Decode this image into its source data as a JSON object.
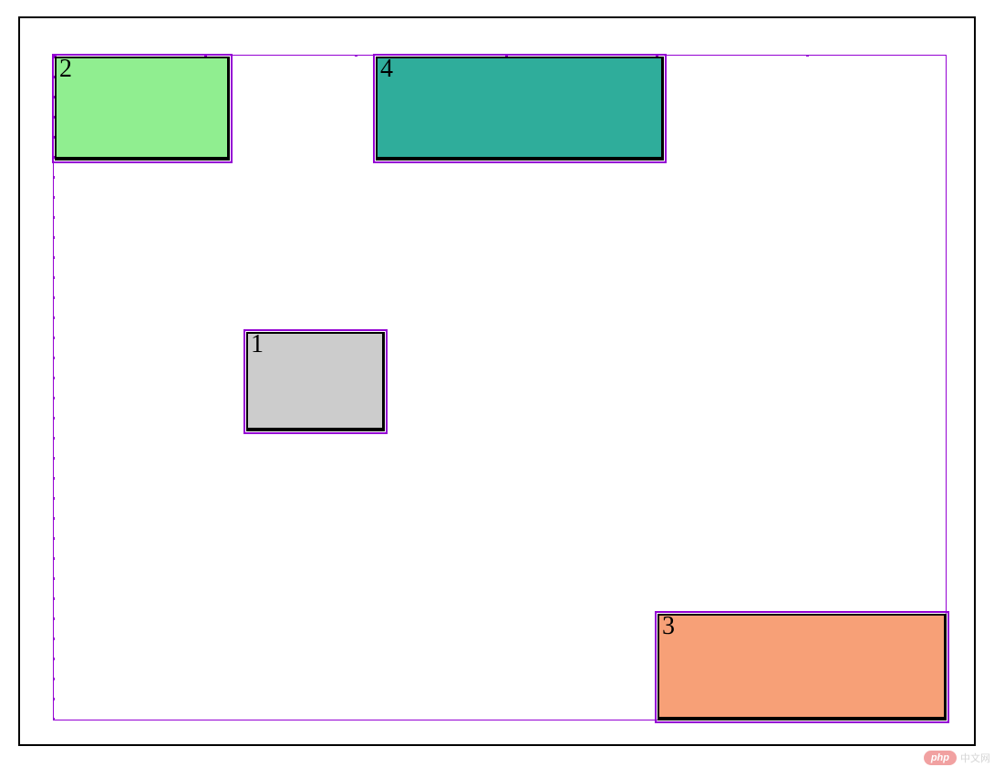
{
  "boxes": {
    "box1": {
      "label": "1",
      "color": "#cccccc"
    },
    "box2": {
      "label": "2",
      "color": "#90ee90"
    },
    "box3": {
      "label": "3",
      "color": "#f7a077"
    },
    "box4": {
      "label": "4",
      "color": "#2fad9b"
    }
  },
  "colors": {
    "outline": "#9400d3",
    "frame": "#000000"
  },
  "watermark": {
    "badge": "php",
    "text": "中文网"
  }
}
